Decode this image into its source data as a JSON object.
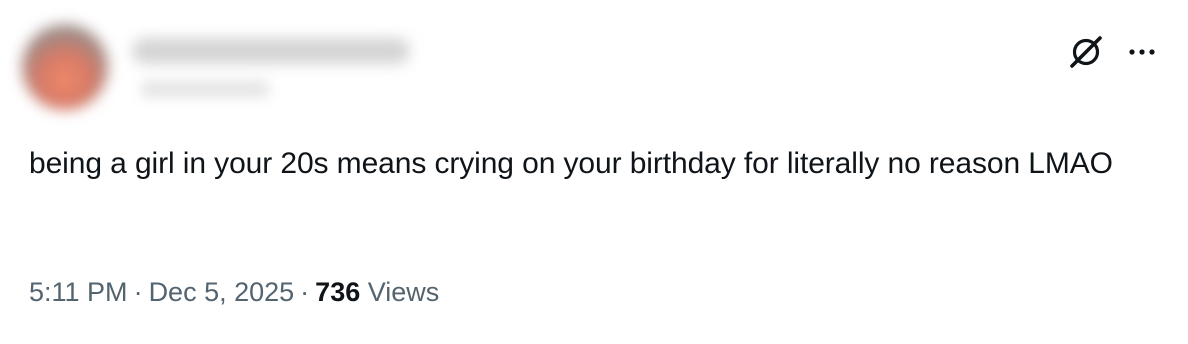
{
  "tweet": {
    "text": "being a girl in your 20s means crying on your birthday for literally no reason LMAO",
    "time": "5:11 PM",
    "date": "Dec 5, 2025",
    "separator": "·",
    "views_count": "736",
    "views_label": "Views"
  },
  "icons": {
    "grok": "grok-icon",
    "more": "more-options-icon"
  },
  "colors": {
    "text": "#0f1419",
    "secondary": "#536471",
    "background": "#ffffff"
  }
}
